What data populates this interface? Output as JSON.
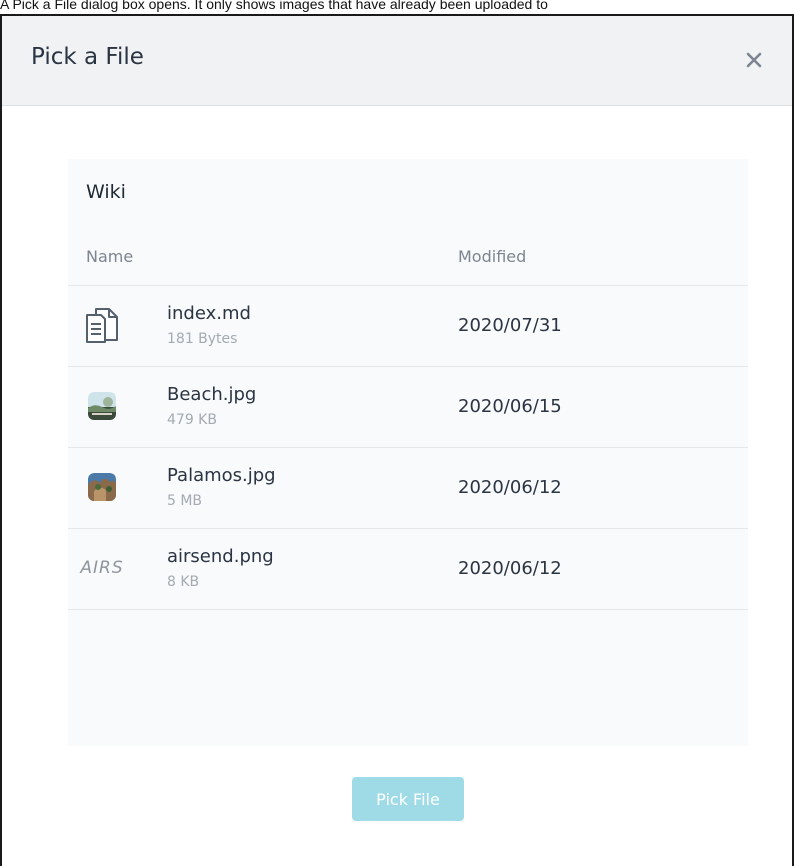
{
  "caption": "A Pick a File dialog box opens. It only shows images that have already been uploaded to",
  "dialog": {
    "title": "Pick a File",
    "close_icon": "close-icon"
  },
  "panel": {
    "title": "Wiki",
    "columns": {
      "name": "Name",
      "modified": "Modified"
    },
    "files": [
      {
        "name": "index.md",
        "size": "181 Bytes",
        "modified": "2020/07/31",
        "icon": "document-icon"
      },
      {
        "name": "Beach.jpg",
        "size": "479 KB",
        "modified": "2020/06/15",
        "icon": "beach-thumbnail"
      },
      {
        "name": "Palamos.jpg",
        "size": "5 MB",
        "modified": "2020/06/12",
        "icon": "palamos-thumbnail"
      },
      {
        "name": "airsend.png",
        "size": "8 KB",
        "modified": "2020/06/12",
        "icon": "airsend-logo",
        "logo_text": "AIRS"
      }
    ]
  },
  "footer": {
    "pick_label": "Pick File"
  },
  "colors": {
    "header_bg": "#f1f2f4",
    "panel_bg": "#f9fafb",
    "button_bg": "#9fdbe7",
    "text": "#2a3442",
    "muted": "#a3aab3"
  }
}
